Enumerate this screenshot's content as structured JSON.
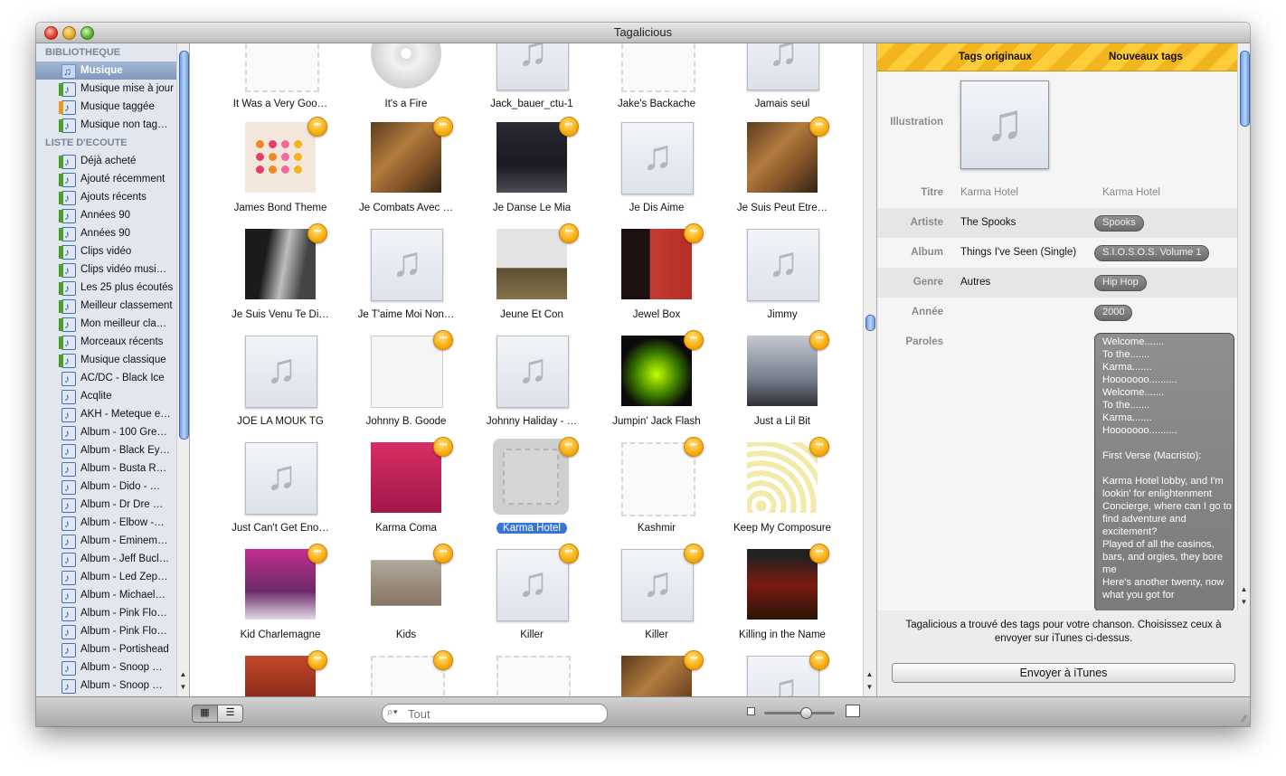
{
  "window": {
    "title": "Tagalicious"
  },
  "sidebar": {
    "section_library": "BIBLIOTHEQUE",
    "library": [
      {
        "label": "Musique",
        "icon": "music-icon",
        "selected": true
      },
      {
        "label": "Musique mise à jour",
        "icon": "smart-playlist-icon"
      },
      {
        "label": "Musique taggée",
        "icon": "smart-playlist-icon"
      },
      {
        "label": "Musique non tag…",
        "icon": "smart-playlist-icon"
      }
    ],
    "section_playlists": "LISTE D'ECOUTE",
    "playlists": [
      {
        "label": "Déjà acheté",
        "icon": "smart-playlist-icon"
      },
      {
        "label": "Ajouté récemment",
        "icon": "smart-playlist-icon"
      },
      {
        "label": "Ajouts récents",
        "icon": "smart-playlist-icon"
      },
      {
        "label": "Années 90",
        "icon": "smart-playlist-icon"
      },
      {
        "label": "Années 90",
        "icon": "smart-playlist-icon"
      },
      {
        "label": "Clips vidéo",
        "icon": "smart-playlist-icon"
      },
      {
        "label": "Clips vidéo musi…",
        "icon": "smart-playlist-icon"
      },
      {
        "label": "Les 25 plus écoutés",
        "icon": "smart-playlist-icon"
      },
      {
        "label": "Meilleur classement",
        "icon": "smart-playlist-icon"
      },
      {
        "label": "Mon meilleur cla…",
        "icon": "smart-playlist-icon"
      },
      {
        "label": "Morceaux récents",
        "icon": "smart-playlist-icon"
      },
      {
        "label": "Musique classique",
        "icon": "smart-playlist-icon"
      },
      {
        "label": "AC/DC - Black Ice",
        "icon": "playlist-icon"
      },
      {
        "label": "Acqlite",
        "icon": "playlist-icon"
      },
      {
        "label": "AKH - Meteque e…",
        "icon": "playlist-icon"
      },
      {
        "label": "Album - 100 Gre…",
        "icon": "playlist-icon"
      },
      {
        "label": "Album - Black Ey…",
        "icon": "playlist-icon"
      },
      {
        "label": "Album - Busta R…",
        "icon": "playlist-icon"
      },
      {
        "label": "Album - Dido - …",
        "icon": "playlist-icon"
      },
      {
        "label": "Album - Dr Dre …",
        "icon": "playlist-icon"
      },
      {
        "label": "Album - Elbow -…",
        "icon": "playlist-icon"
      },
      {
        "label": "Album - Eminem…",
        "icon": "playlist-icon"
      },
      {
        "label": "Album - Jeff Bucl…",
        "icon": "playlist-icon"
      },
      {
        "label": "Album - Led Zep…",
        "icon": "playlist-icon"
      },
      {
        "label": "Album - Michael…",
        "icon": "playlist-icon"
      },
      {
        "label": "Album - Pink Flo…",
        "icon": "playlist-icon"
      },
      {
        "label": "Album - Pink Flo…",
        "icon": "playlist-icon"
      },
      {
        "label": "Album - Portishead",
        "icon": "playlist-icon"
      },
      {
        "label": "Album - Snoop …",
        "icon": "playlist-icon"
      },
      {
        "label": "Album - Snoop …",
        "icon": "playlist-icon"
      }
    ]
  },
  "grid": {
    "rows": [
      [
        {
          "title": "It Was a Very Goo…",
          "art": "empty",
          "badge": false
        },
        {
          "title": "It's a Fire",
          "art": "cd",
          "badge": false
        },
        {
          "title": "Jack_bauer_ctu-1",
          "art": "placeholder",
          "badge": false
        },
        {
          "title": "Jake's Backache",
          "art": "empty",
          "badge": false
        },
        {
          "title": "Jamais seul",
          "art": "placeholder",
          "badge": false
        }
      ],
      [
        {
          "title": "James Bond Theme",
          "art": "a-pink",
          "badge": true
        },
        {
          "title": "Je Combats Avec …",
          "art": "a-brown",
          "badge": true
        },
        {
          "title": "Je Danse Le Mia",
          "art": "a-dark",
          "badge": true
        },
        {
          "title": "Je Dis Aime",
          "art": "placeholder",
          "badge": false
        },
        {
          "title": "Je Suis Peut Être…",
          "art": "a-brown",
          "badge": true
        }
      ],
      [
        {
          "title": "Je Suis Venu Te Di…",
          "art": "a-bw",
          "badge": true
        },
        {
          "title": "Je T'aime Moi Non…",
          "art": "placeholder",
          "badge": false
        },
        {
          "title": "Jeune Et Con",
          "art": "a-field",
          "badge": true
        },
        {
          "title": "Jewel Box",
          "art": "a-jb",
          "badge": true
        },
        {
          "title": "Jimmy",
          "art": "placeholder",
          "badge": false
        }
      ],
      [
        {
          "title": "JOE LA MOUK TG",
          "art": "placeholder",
          "badge": false
        },
        {
          "title": "Johnny B. Goode",
          "art": "a-white",
          "badge": true
        },
        {
          "title": "Johnny Haliday - …",
          "art": "placeholder",
          "badge": false
        },
        {
          "title": "Jumpin' Jack Flash",
          "art": "a-stones",
          "badge": true
        },
        {
          "title": "Just a Lil Bit",
          "art": "a-fifty",
          "badge": true
        }
      ],
      [
        {
          "title": "Just Can't Get Eno…",
          "art": "placeholder",
          "badge": false
        },
        {
          "title": "Karma Coma",
          "art": "a-magenta",
          "badge": true
        },
        {
          "title": "Karma Hotel",
          "art": "selected",
          "badge": true
        },
        {
          "title": "Kashmir",
          "art": "empty",
          "badge": true
        },
        {
          "title": "Keep My Composure",
          "art": "a-yellow",
          "badge": true
        }
      ],
      [
        {
          "title": "Kid Charlemagne",
          "art": "a-purple",
          "badge": true
        },
        {
          "title": "Kids",
          "art": "a-kids",
          "badge": true
        },
        {
          "title": "Killer",
          "art": "placeholder",
          "badge": true
        },
        {
          "title": "Killer",
          "art": "placeholder",
          "badge": true
        },
        {
          "title": "Killing in the Name",
          "art": "a-rage",
          "badge": true
        }
      ],
      [
        {
          "title": "",
          "art": "a-prince",
          "badge": true
        },
        {
          "title": "",
          "art": "empty",
          "badge": true
        },
        {
          "title": "",
          "art": "empty",
          "badge": false
        },
        {
          "title": "",
          "art": "a-brown",
          "badge": true
        },
        {
          "title": "",
          "art": "placeholder",
          "badge": true
        }
      ]
    ]
  },
  "tags": {
    "col_original": "Tags originaux",
    "col_new": "Nouveaux tags",
    "illustration_label": "Illustration",
    "fields": [
      {
        "key": "Titre",
        "original": "Karma Hotel",
        "new": "Karma Hotel",
        "new_style": "text"
      },
      {
        "key": "Artiste",
        "original": "The Spooks",
        "new": "Spooks",
        "new_style": "pill"
      },
      {
        "key": "Album",
        "original": "Things I've Seen (Single)",
        "new": "S.I.O.S.O.S. Volume 1",
        "new_style": "pill"
      },
      {
        "key": "Genre",
        "original": "Autres",
        "new": "Hip Hop",
        "new_style": "pill"
      },
      {
        "key": "Année",
        "original": "",
        "new": "2000",
        "new_style": "pill"
      }
    ],
    "lyrics_label": "Paroles",
    "lyrics": "Welcome.......\nTo the.......\nKarma.......\nHooooooo..........\nWelcome.......\nTo the.......\nKarma.......\nHooooooo..........\n\nFirst Verse (Macristo):\n\nKarma Hotel lobby, and I'm lookin' for enlightenment\nConcierge, where can I go to find adventure and excitement?\nPlayed of all the casinos, bars, and orgies, they bore me\nHere's another twenty, now what you got for",
    "footer_message": "Tagalicious a trouvé des tags pour votre chanson. Choisissez ceux à envoyer sur iTunes ci-dessus.",
    "send_button": "Envoyer à iTunes"
  },
  "bottombar": {
    "search_placeholder": "Tout"
  }
}
